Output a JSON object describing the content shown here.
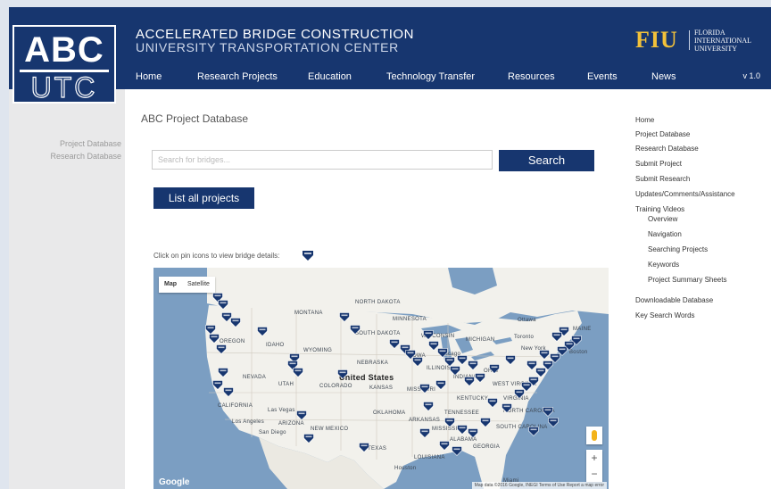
{
  "header": {
    "logo_top": "ABC",
    "logo_bottom": "UTC",
    "title_line1": "ACCELERATED BRIDGE CONSTRUCTION",
    "title_line2": "UNIVERSITY TRANSPORTATION CENTER",
    "fiu_mark": "FIU",
    "fiu_name_1": "FLORIDA",
    "fiu_name_2": "INTERNATIONAL",
    "fiu_name_3": "UNIVERSITY",
    "version": "v 1.0",
    "nav": [
      "Home",
      "Research Projects",
      "Education",
      "Technology Transfer",
      "Resources",
      "Events",
      "News"
    ]
  },
  "left_sidebar": {
    "links": [
      "Project Database",
      "Research Database"
    ]
  },
  "main": {
    "page_title": "ABC Project Database",
    "search_placeholder": "Search for bridges...",
    "search_button": "Search",
    "list_all_button": "List all projects",
    "hint": "Click on pin icons to view bridge details:"
  },
  "map": {
    "tabs": [
      "Map",
      "Satellite"
    ],
    "country_label": "United States",
    "state_labels": [
      "MONTANA",
      "NORTH DAKOTA",
      "MINNESOTA",
      "SOUTH DAKOTA",
      "OREGON",
      "IDAHO",
      "WYOMING",
      "NEBRASKA",
      "IOWA",
      "ILLINOIS",
      "OHIO",
      "INDIANA",
      "NEVADA",
      "UTAH",
      "COLORADO",
      "KANSAS",
      "MISSOURI",
      "KENTUCKY",
      "WEST VIRGINIA",
      "VIRGINIA",
      "CALIFORNIA",
      "ARIZONA",
      "NEW MEXICO",
      "OKLAHOMA",
      "ARKANSAS",
      "TENNESSEE",
      "NORTH CAROLINA",
      "SOUTH CAROLINA",
      "MISSISSIPPI",
      "ALABAMA",
      "GEORGIA",
      "TEXAS",
      "LOUISIANA",
      "MICHIGAN",
      "WISCONSIN",
      "MAINE"
    ],
    "city_labels": [
      "Los Angeles",
      "San Diego",
      "Las Vegas",
      "Toronto",
      "Ottawa",
      "New York",
      "Chicago",
      "Boston",
      "Houston",
      "Miami"
    ],
    "google_logo": "Google",
    "attribution": "Map data ©2016 Google, INEGI   Terms of Use   Report a map error",
    "zoom_in": "+",
    "zoom_out": "−",
    "colors": {
      "water": "#7b9ec2",
      "land": "#f2f1ec",
      "pin": "#17366f"
    }
  },
  "right_sidebar": {
    "links": [
      "Home",
      "Project Database",
      "Research Database",
      "Submit Project",
      "Submit Research",
      "Updates/Comments/Assistance",
      "Training Videos"
    ],
    "training_sub": [
      "Overview",
      "Navigation",
      "Searching Projects",
      "Keywords",
      "Project Summary Sheets"
    ],
    "links_bottom": [
      "Downloadable Database",
      "Key Search Words"
    ]
  },
  "colors": {
    "brand_navy": "#17366f",
    "fiu_gold": "#f2c13a"
  }
}
